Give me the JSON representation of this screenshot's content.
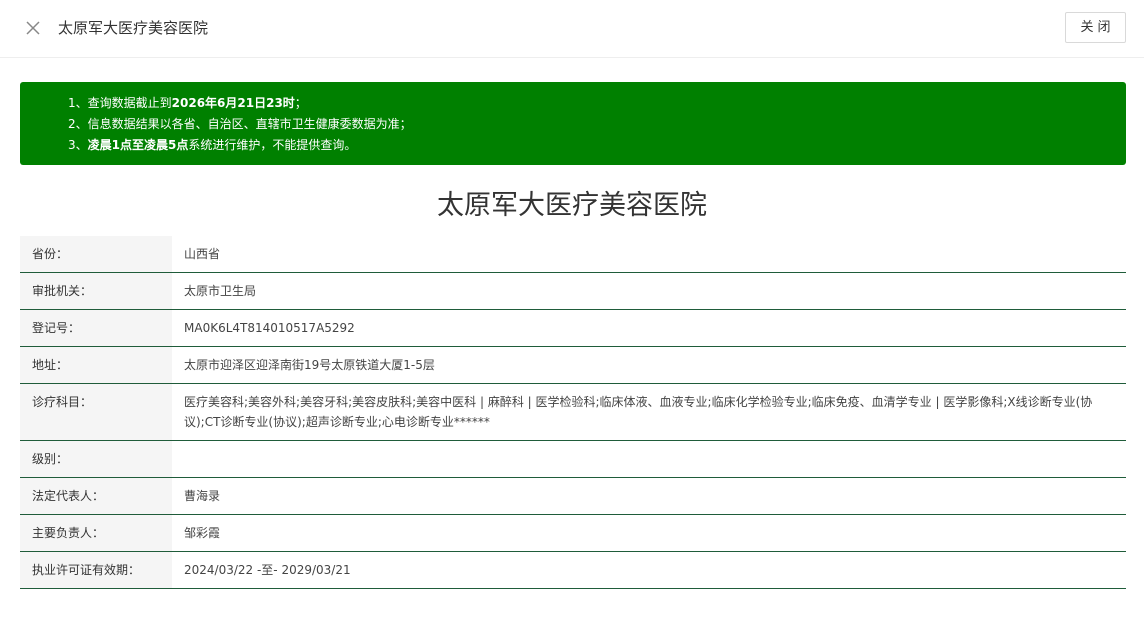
{
  "header": {
    "title": "太原军大医疗美容医院",
    "close_label": "关闭",
    "close_icon": "close-icon"
  },
  "notice": {
    "line1_prefix": "1、查询数据截止到",
    "line1_bold": "2026年6月21日23时",
    "line1_suffix": "；",
    "line2": "2、信息数据结果以各省、自治区、直辖市卫生健康委数据为准；",
    "line3_prefix": "3、",
    "line3_bold": "凌晨1点至凌晨5点",
    "line3_suffix": "系统进行维护，不能提供查询。",
    "bg_color": "#008000"
  },
  "main": {
    "title": "太原军大医疗美容医院"
  },
  "rows": [
    {
      "label": "省份：",
      "value": "山西省"
    },
    {
      "label": "审批机关：",
      "value": "太原市卫生局"
    },
    {
      "label": "登记号：",
      "value": "MA0K6L4T814010517A5292"
    },
    {
      "label": "地址：",
      "value": "太原市迎泽区迎泽南街19号太原铁道大厦1-5层"
    },
    {
      "label": "诊疗科目：",
      "value": "医疗美容科;美容外科;美容牙科;美容皮肤科;美容中医科 | 麻醉科 | 医学检验科;临床体液、血液专业;临床化学检验专业;临床免疫、血清学专业 | 医学影像科;X线诊断专业(协议);CT诊断专业(协议);超声诊断专业;心电诊断专业******"
    },
    {
      "label": "级别：",
      "value": ""
    },
    {
      "label": "法定代表人：",
      "value": "曹海录"
    },
    {
      "label": "主要负责人：",
      "value": "邹彩霞"
    },
    {
      "label": "执业许可证有效期：",
      "value": "2024/03/22 -至- 2029/03/21"
    }
  ]
}
